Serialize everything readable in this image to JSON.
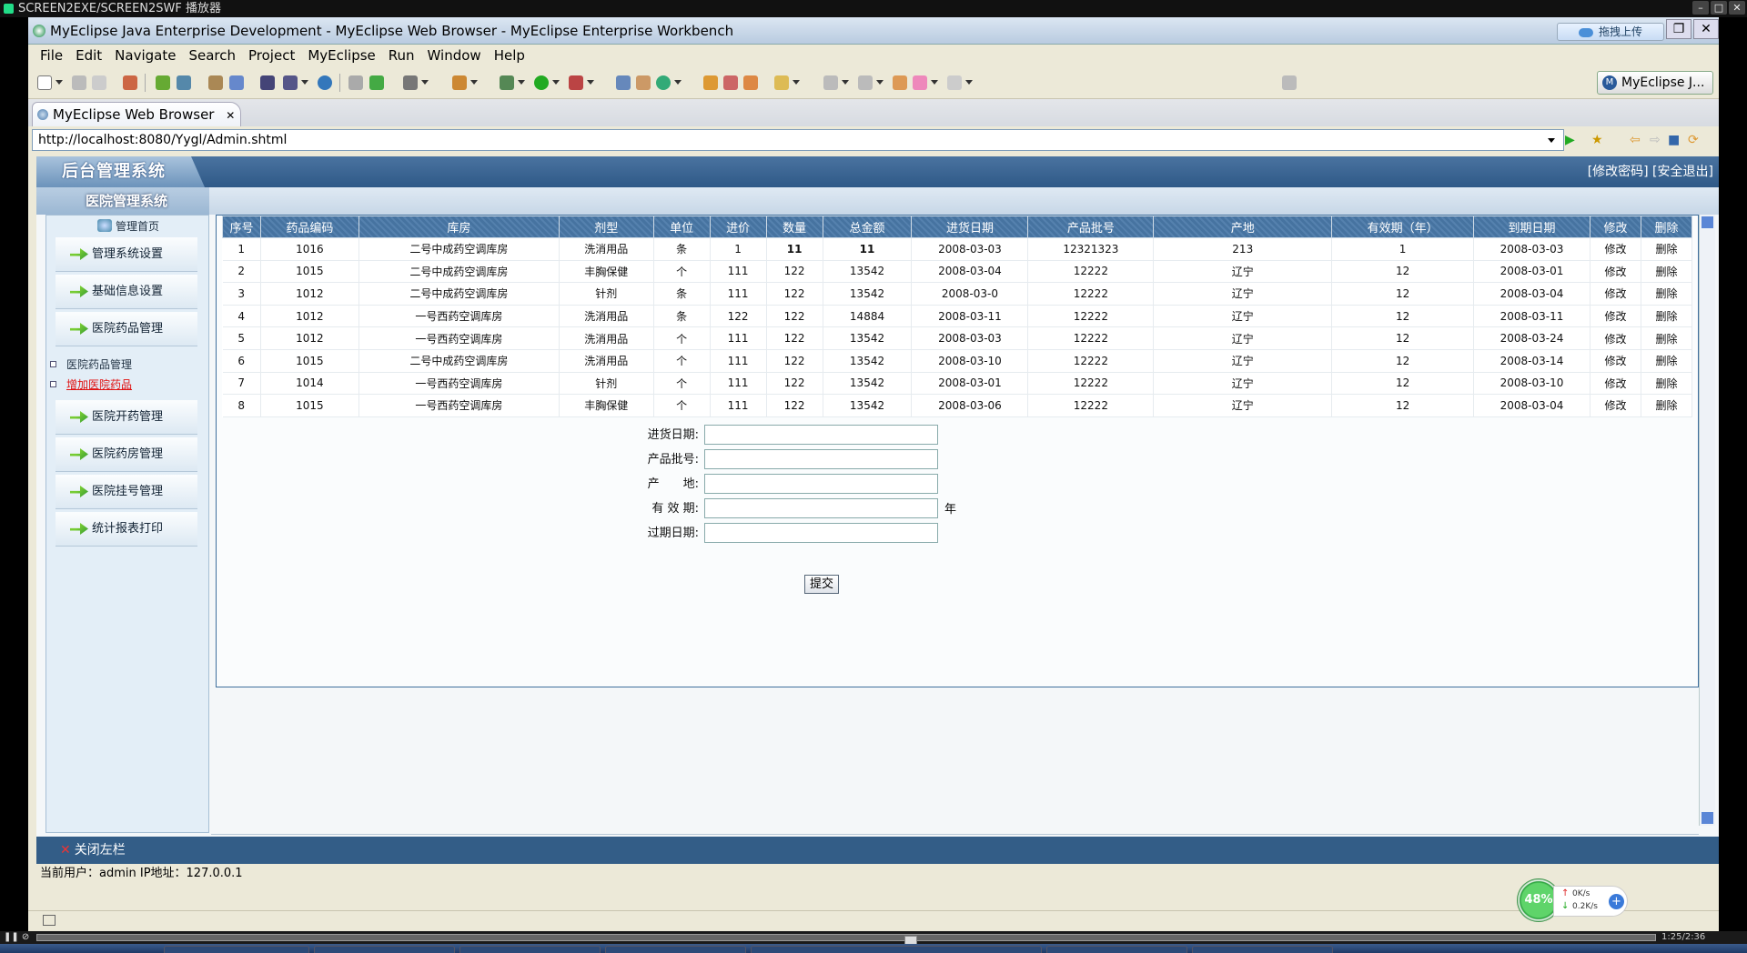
{
  "player": {
    "title": "SCREEN2EXE/SCREEN2SWF 播放器",
    "time": "1:25/2:36",
    "progress": 0.54
  },
  "window": {
    "title": "MyEclipse Java Enterprise Development - MyEclipse Web Browser - MyEclipse Enterprise Workbench",
    "upload_label": "拖拽上传",
    "minimize_icon": "minimize-icon",
    "restore_icon": "restore-icon",
    "close_icon": "close-icon"
  },
  "menu": [
    "File",
    "Edit",
    "Navigate",
    "Search",
    "Project",
    "MyEclipse",
    "Run",
    "Window",
    "Help"
  ],
  "perspective": {
    "label": "MyEclipse J..."
  },
  "editor_tab": {
    "label": "MyEclipse Web Browser",
    "close": "✕"
  },
  "url": "http://localhost:8080/Yygl/Admin.shtml",
  "site": {
    "logo": "后台管理系统",
    "name": "医院管理系统",
    "header_links": "[修改密码] [安全退出]",
    "home_label": "管理首页"
  },
  "sidebar": {
    "items_top": [
      "管理系统设置",
      "基础信息设置",
      "医院药品管理"
    ],
    "sub_items": [
      {
        "label": "医院药品管理",
        "active": false
      },
      {
        "label": "增加医院药品",
        "active": true
      }
    ],
    "items_bottom": [
      "医院开药管理",
      "医院药房管理",
      "医院挂号管理",
      "统计报表打印"
    ]
  },
  "table": {
    "headers": [
      "序号",
      "药品编码",
      "库房",
      "剂型",
      "单位",
      "进价",
      "数量",
      "总金额",
      "进货日期",
      "产品批号",
      "产地",
      "有效期（年）",
      "到期日期",
      "修改",
      "删除"
    ],
    "rows": [
      [
        "1",
        "1016",
        "二号中成药空调库房",
        "洗消用品",
        "条",
        "1",
        "11",
        "11",
        "2008-03-03",
        "12321323",
        "213",
        "1",
        "2008-03-03",
        "修改",
        "删除"
      ],
      [
        "2",
        "1015",
        "二号中成药空调库房",
        "丰胸保健",
        "个",
        "111",
        "122",
        "13542",
        "2008-03-04",
        "12222",
        "辽宁",
        "12",
        "2008-03-01",
        "修改",
        "删除"
      ],
      [
        "3",
        "1012",
        "二号中成药空调库房",
        "针剂",
        "条",
        "111",
        "122",
        "13542",
        "2008-03-0",
        "12222",
        "辽宁",
        "12",
        "2008-03-04",
        "修改",
        "删除"
      ],
      [
        "4",
        "1012",
        "一号西药空调库房",
        "洗消用品",
        "条",
        "122",
        "122",
        "14884",
        "2008-03-11",
        "12222",
        "辽宁",
        "12",
        "2008-03-11",
        "修改",
        "删除"
      ],
      [
        "5",
        "1012",
        "一号西药空调库房",
        "洗消用品",
        "个",
        "111",
        "122",
        "13542",
        "2008-03-03",
        "12222",
        "辽宁",
        "12",
        "2008-03-24",
        "修改",
        "删除"
      ],
      [
        "6",
        "1015",
        "二号中成药空调库房",
        "洗消用品",
        "个",
        "111",
        "122",
        "13542",
        "2008-03-10",
        "12222",
        "辽宁",
        "12",
        "2008-03-14",
        "修改",
        "删除"
      ],
      [
        "7",
        "1014",
        "一号西药空调库房",
        "针剂",
        "个",
        "111",
        "122",
        "13542",
        "2008-03-01",
        "12222",
        "辽宁",
        "12",
        "2008-03-10",
        "修改",
        "删除"
      ],
      [
        "8",
        "1015",
        "一号西药空调库房",
        "丰胸保健",
        "个",
        "111",
        "122",
        "13542",
        "2008-03-06",
        "12222",
        "辽宁",
        "12",
        "2008-03-04",
        "修改",
        "删除"
      ]
    ]
  },
  "form": {
    "fields": [
      {
        "label": "进货日期:",
        "value": ""
      },
      {
        "label": "产品批号:",
        "value": ""
      },
      {
        "label": "产　　地:",
        "value": ""
      },
      {
        "label": "有 效 期:",
        "value": "",
        "suffix": "年"
      },
      {
        "label": "过期日期:",
        "value": ""
      }
    ],
    "submit": "提交"
  },
  "footer": {
    "close_sidebar": "关闭左栏",
    "status": "当前用户：admin  IP地址：127.0.0.1"
  },
  "speed": {
    "percent": "48%",
    "up": "0K/s",
    "down": "0.2K/s"
  }
}
